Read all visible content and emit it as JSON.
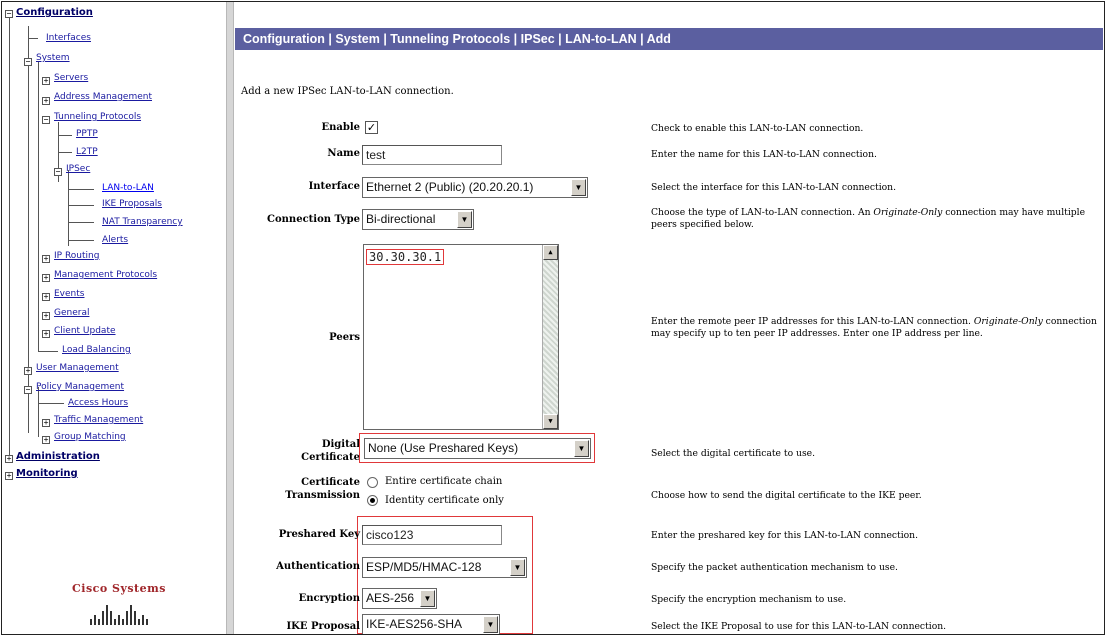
{
  "nav": {
    "configuration": "Configuration",
    "interfaces": "Interfaces",
    "system": "System",
    "servers": "Servers",
    "address_management": "Address Management",
    "tunneling_protocols": "Tunneling Protocols",
    "pptp": "PPTP",
    "l2tp": "L2TP",
    "ipsec": "IPSec",
    "lan_to_lan": "LAN-to-LAN",
    "ike_proposals": "IKE Proposals",
    "nat_transparency": "NAT Transparency",
    "alerts": "Alerts",
    "ip_routing": "IP Routing",
    "management_protocols": "Management Protocols",
    "events": "Events",
    "general": "General",
    "client_update": "Client Update",
    "load_balancing": "Load Balancing",
    "user_management": "User Management",
    "policy_management": "Policy Management",
    "access_hours": "Access Hours",
    "traffic_management": "Traffic Management",
    "group_matching": "Group Matching",
    "administration": "Administration",
    "monitoring": "Monitoring"
  },
  "logo": {
    "text": "Cisco Systems"
  },
  "header": {
    "title": "Configuration | System | Tunneling Protocols | IPSec | LAN-to-LAN | Add"
  },
  "intro": "Add a new IPSec LAN-to-LAN connection.",
  "form": {
    "enable": {
      "label": "Enable",
      "checked": true,
      "help": "Check to enable this LAN-to-LAN connection."
    },
    "name": {
      "label": "Name",
      "value": "test",
      "help": "Enter the name for this LAN-to-LAN connection."
    },
    "interface": {
      "label": "Interface",
      "value": "Ethernet 2 (Public) (20.20.20.1)",
      "help": "Select the interface for this LAN-to-LAN connection."
    },
    "connection_type": {
      "label": "Connection Type",
      "value": "Bi-directional",
      "help_a": "Choose the type of LAN-to-LAN connection. An ",
      "help_em": "Originate-Only",
      "help_b": " connection may have multiple peers specified below."
    },
    "peers": {
      "label": "Peers",
      "value": "30.30.30.1",
      "help_a": "Enter the remote peer IP addresses for this LAN-to-LAN connection. ",
      "help_em": "Originate-Only",
      "help_b": " connection may specify up to ten peer IP addresses. Enter one IP address per line."
    },
    "digital_certificate": {
      "label_1": "Digital",
      "label_2": "Certificate",
      "value": "None (Use Preshared Keys)",
      "help": "Select the digital certificate to use."
    },
    "certificate_transmission": {
      "label_1": "Certificate",
      "label_2": "Transmission",
      "option_1": "Entire certificate chain",
      "option_2": "Identity certificate only",
      "selected": "Identity certificate only",
      "help": "Choose how to send the digital certificate to the IKE peer."
    },
    "preshared_key": {
      "label": "Preshared Key",
      "value": "cisco123",
      "help": "Enter the preshared key for this LAN-to-LAN connection."
    },
    "authentication": {
      "label": "Authentication",
      "value": "ESP/MD5/HMAC-128",
      "help": "Specify the packet authentication mechanism to use."
    },
    "encryption": {
      "label": "Encryption",
      "value": "AES-256",
      "help": "Specify the encryption mechanism to use."
    },
    "ike_proposal": {
      "label": "IKE Proposal",
      "value": "IKE-AES256-SHA",
      "help": "Select the IKE Proposal to use for this LAN-to-LAN connection."
    }
  },
  "colors": {
    "title_bar": "#5b5fa0",
    "highlight": "#e0383a",
    "nav_link": "#1a1aa0"
  }
}
